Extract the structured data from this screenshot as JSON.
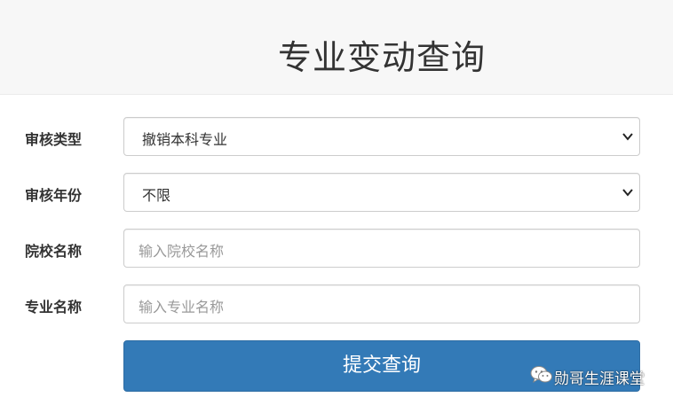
{
  "page": {
    "title": "专业变动查询"
  },
  "form": {
    "review_type": {
      "label": "审核类型",
      "selected": "撤销本科专业"
    },
    "review_year": {
      "label": "审核年份",
      "selected": "不限"
    },
    "school_name": {
      "label": "院校名称",
      "placeholder": "输入院校名称"
    },
    "major_name": {
      "label": "专业名称",
      "placeholder": "输入专业名称"
    },
    "submit_label": "提交查询"
  },
  "watermark": {
    "icon": "wechat-icon",
    "text": "勋哥生涯课堂"
  },
  "colors": {
    "primary_button": "#337ab7",
    "header_bg": "#f7f7f7",
    "border": "#cccccc"
  }
}
